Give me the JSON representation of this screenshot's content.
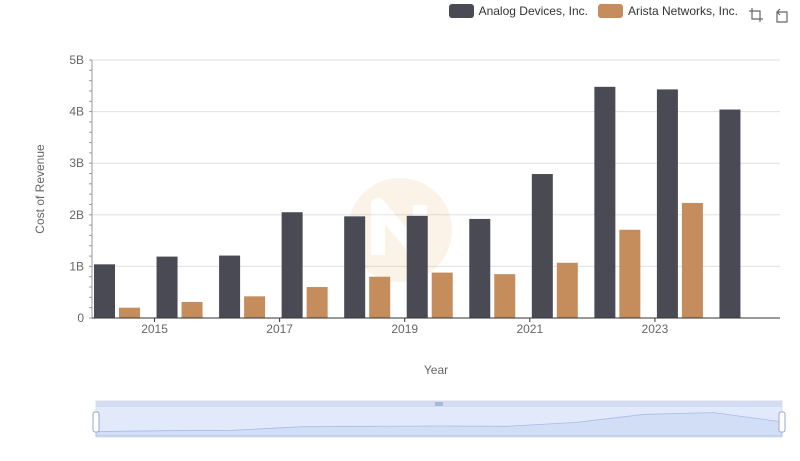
{
  "chart_data": {
    "type": "bar",
    "x": [
      2014,
      2015,
      2016,
      2017,
      2018,
      2019,
      2020,
      2021,
      2022,
      2023,
      2024
    ],
    "x_tick_labels": [
      "2015",
      "2017",
      "2019",
      "2021",
      "2023"
    ],
    "y_tick_labels": [
      "0",
      "1B",
      "2B",
      "3B",
      "4B",
      "5B"
    ],
    "ylim": [
      0,
      5000000000
    ],
    "ylabel": "Cost of Revenue",
    "xlabel": "Year",
    "legend_position": "top-right",
    "grid": true,
    "series": [
      {
        "name": "Analog Devices, Inc.",
        "color": "#4a4a55",
        "values": [
          1040000000,
          1190000000,
          1210000000,
          2050000000,
          1970000000,
          1980000000,
          1920000000,
          2790000000,
          4480000000,
          4430000000,
          4040000000
        ]
      },
      {
        "name": "Arista Networks, Inc.",
        "color": "#c68d5c",
        "values": [
          200000000,
          310000000,
          420000000,
          600000000,
          800000000,
          880000000,
          850000000,
          1070000000,
          1710000000,
          2230000000,
          null
        ]
      }
    ]
  },
  "toolbox": {
    "zoom_icon": "zoom-icon",
    "restore_icon": "restore-icon"
  }
}
